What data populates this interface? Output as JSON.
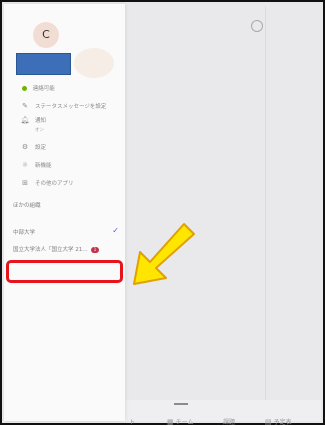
{
  "drawer": {
    "avatar_initial": "C",
    "menu": [
      {
        "icon": "status-icon",
        "label": "連絡可能"
      },
      {
        "icon": "edit-icon",
        "label": "ステータスメッセージを設定"
      },
      {
        "icon": "bell-icon",
        "label": "通知",
        "sub": "オン"
      },
      {
        "icon": "gear-icon",
        "label": "設定"
      },
      {
        "icon": "lightbulb-icon",
        "label": "新機能"
      },
      {
        "icon": "apps-icon",
        "label": "その他のアプリ"
      }
    ],
    "section_label": "ほかの組織",
    "orgs": [
      {
        "label": "中部大学",
        "selected": true
      },
      {
        "label": "国立大学法人「国立大学 21…",
        "badge": "1"
      }
    ]
  },
  "bottom_tabs": [
    {
      "label": "ト",
      "icon": ""
    },
    {
      "label": "チーム",
      "icon": "teams-icon"
    },
    {
      "label": "課題",
      "icon": ""
    },
    {
      "label": "予定表",
      "icon": "calendar-icon"
    }
  ],
  "colors": {
    "highlight": "#e8141c",
    "arrow": "#ffe600",
    "name_block": "#3d6fb8"
  }
}
